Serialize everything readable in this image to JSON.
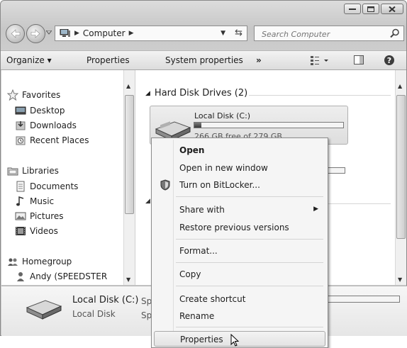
{
  "address": {
    "crumb": "Computer",
    "search_placeholder": "Search Computer"
  },
  "toolbar": {
    "organize": "Organize ▾",
    "properties": "Properties",
    "system_properties": "System properties",
    "more": "»"
  },
  "nav": {
    "favorites": "Favorites",
    "desktop": "Desktop",
    "downloads": "Downloads",
    "recent_places": "Recent Places",
    "libraries": "Libraries",
    "documents": "Documents",
    "music": "Music",
    "pictures": "Pictures",
    "videos": "Videos",
    "homegroup": "Homegroup",
    "andy": "Andy (SPEEDSTER"
  },
  "content": {
    "group_header": "Hard Disk Drives (2)",
    "drive_name": "Local Disk (C:)",
    "drive_free": "266 GB free of 279 GB",
    "drive_used_fraction": 0.047
  },
  "details": {
    "name": "Local Disk (C:)",
    "type": "Local Disk",
    "sp1": "Sp",
    "sp2": "Sp"
  },
  "context_menu": {
    "open": "Open",
    "open_new_window": "Open in new window",
    "bitlocker": "Turn on BitLocker...",
    "share_with": "Share with",
    "restore": "Restore previous versions",
    "format": "Format...",
    "copy": "Copy",
    "create_shortcut": "Create shortcut",
    "rename": "Rename",
    "properties": "Properties"
  }
}
